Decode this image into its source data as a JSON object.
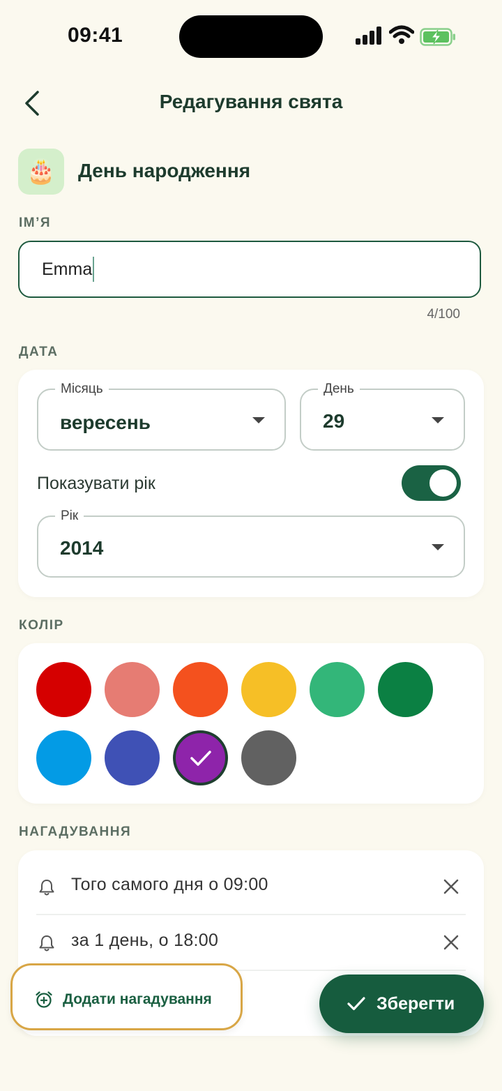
{
  "status": {
    "time": "09:41"
  },
  "header": {
    "title": "Редагування свята"
  },
  "category": {
    "emoji": "🎂",
    "name": "День народження"
  },
  "name_section": {
    "label": "ІМ’Я",
    "value": "Emma",
    "counter": "4/100"
  },
  "date_section": {
    "label": "ДАТА",
    "month": {
      "label": "Місяць",
      "value": "вересень"
    },
    "day": {
      "label": "День",
      "value": "29"
    },
    "show_year": {
      "label": "Показувати рік",
      "enabled": true
    },
    "year": {
      "label": "Рік",
      "value": "2014"
    }
  },
  "color_section": {
    "label": "КОЛІР",
    "swatches": [
      "#d50000",
      "#e67c73",
      "#f4511e",
      "#f6bf26",
      "#33b679",
      "#0b8043",
      "#039be5",
      "#3f51b5",
      "#8e24aa",
      "#616161"
    ],
    "selected_index": 8
  },
  "reminders_section": {
    "label": "НАГАДУВАННЯ",
    "items": [
      {
        "text": "Того самого дня о 09:00"
      },
      {
        "text": "за 1 день, о 18:00"
      }
    ],
    "add_label": "Додати нагадування"
  },
  "actions": {
    "save_label": "Зберегти"
  },
  "colors": {
    "primary": "#165c3e",
    "background": "#fbf9ef",
    "highlight": "#d8a646"
  }
}
